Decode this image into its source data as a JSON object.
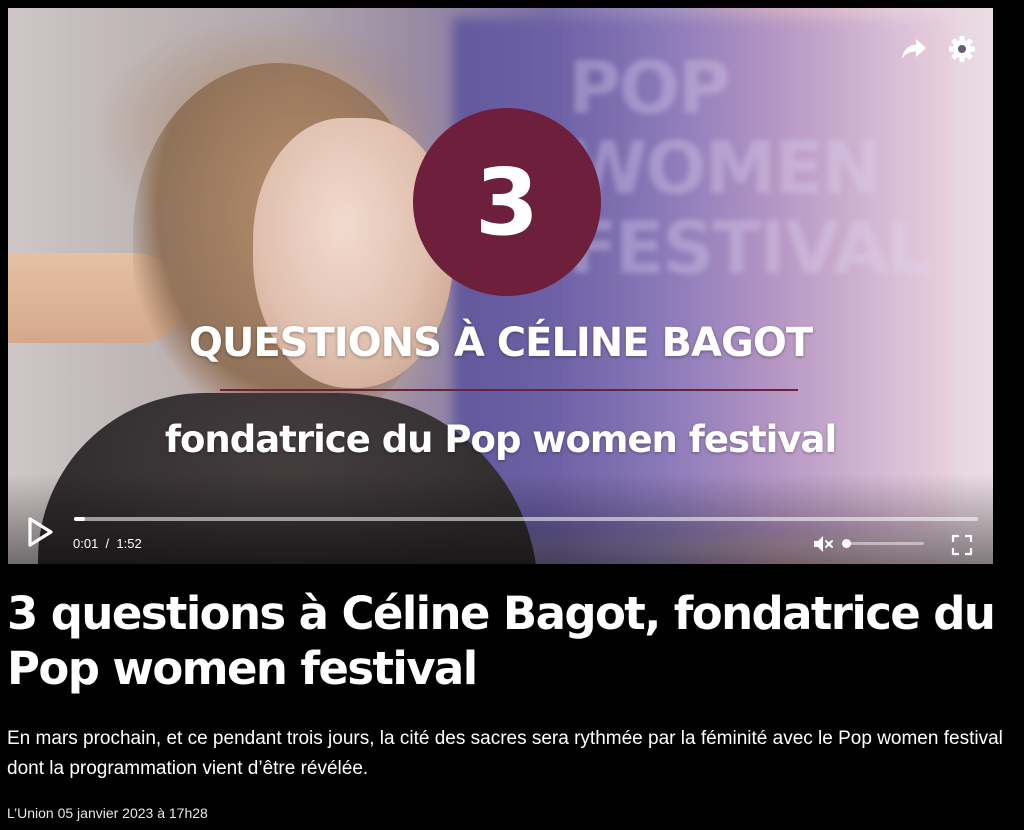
{
  "video": {
    "overlay_number": "3",
    "overlay_title": "QUESTIONS À CÉLINE BAGOT",
    "overlay_subtitle": "fondatrice du Pop women festival",
    "background_sign_text": "POP WOMEN FESTIVAL",
    "time_current": "0:01",
    "time_separator": "/",
    "time_total": "1:52",
    "progress": 0.01,
    "volume_level": 0.0,
    "muted": true,
    "icons": {
      "share": "share-arrow-icon",
      "settings": "gear-icon",
      "play": "play-icon",
      "mute": "volume-muted-icon",
      "fullscreen": "fullscreen-icon"
    },
    "accent_color": "#6e1f3b"
  },
  "article": {
    "headline": "3 questions à Céline Bagot, fondatrice du Pop women festival",
    "lead": "En mars prochain, et ce pendant trois jours, la cité des sacres sera rythmée par la féminité avec le Pop women festival dont la programmation vient d’être révélée.",
    "source_date": "L’Union 05 janvier 2023 à 17h28"
  }
}
